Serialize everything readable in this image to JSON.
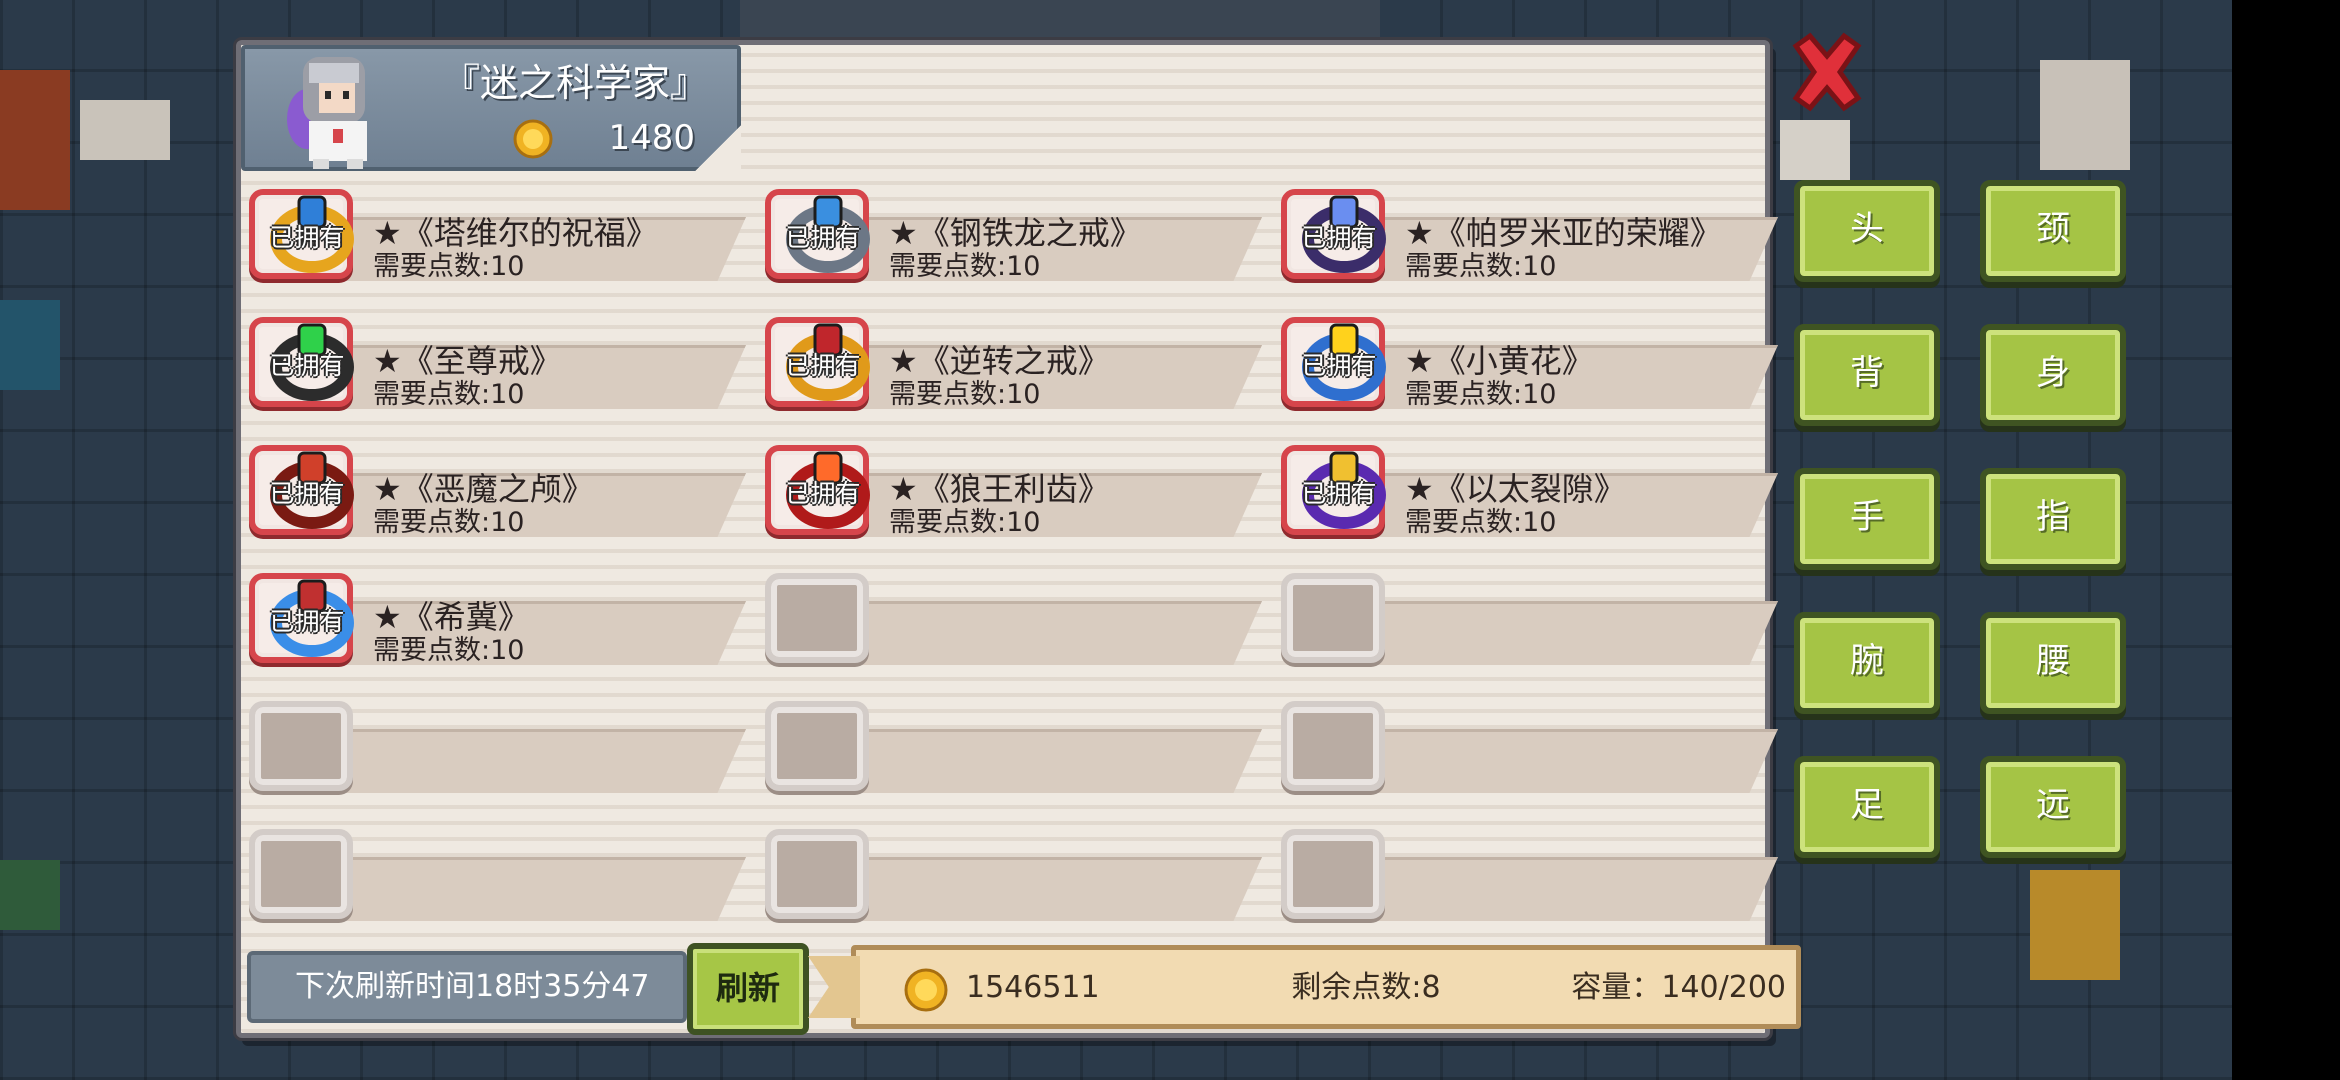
{
  "character": {
    "title": "『迷之科学家』",
    "coins": "1480"
  },
  "owned_label": "已拥有",
  "items": [
    {
      "name": "★《塔维尔的祝福》",
      "cost": "需要点数:10",
      "icon": "ring-gold-blue-gem-icon",
      "owned": true
    },
    {
      "name": "★《钢铁龙之戒》",
      "cost": "需要点数:10",
      "icon": "ring-steel-dragon-icon",
      "owned": true
    },
    {
      "name": "★《帕罗米亚的荣耀》",
      "cost": "需要点数:10",
      "icon": "ring-purple-crystal-icon",
      "owned": true
    },
    {
      "name": "★《至尊戒》",
      "cost": "需要点数:10",
      "icon": "ring-green-gem-icon",
      "owned": true
    },
    {
      "name": "★《逆转之戒》",
      "cost": "需要点数:10",
      "icon": "ring-red-gold-icon",
      "owned": true
    },
    {
      "name": "★《小黄花》",
      "cost": "需要点数:10",
      "icon": "ring-yellow-flower-icon",
      "owned": true
    },
    {
      "name": "★《恶魔之颅》",
      "cost": "需要点数:10",
      "icon": "ring-demon-skull-icon",
      "owned": true
    },
    {
      "name": "★《狼王利齿》",
      "cost": "需要点数:10",
      "icon": "ring-wolf-fang-icon",
      "owned": true
    },
    {
      "name": "★《以太裂隙》",
      "cost": "需要点数:10",
      "icon": "ring-ether-rift-icon",
      "owned": true
    },
    {
      "name": "★《希冀》",
      "cost": "需要点数:10",
      "icon": "ring-blue-hope-icon",
      "owned": true
    },
    {
      "name": "",
      "cost": "",
      "icon": "",
      "owned": false
    },
    {
      "name": "",
      "cost": "",
      "icon": "",
      "owned": false
    },
    {
      "name": "",
      "cost": "",
      "icon": "",
      "owned": false
    },
    {
      "name": "",
      "cost": "",
      "icon": "",
      "owned": false
    },
    {
      "name": "",
      "cost": "",
      "icon": "",
      "owned": false
    },
    {
      "name": "",
      "cost": "",
      "icon": "",
      "owned": false
    },
    {
      "name": "",
      "cost": "",
      "icon": "",
      "owned": false
    },
    {
      "name": "",
      "cost": "",
      "icon": "",
      "owned": false
    }
  ],
  "footer": {
    "refresh_time": "下次刷新时间18时35分47",
    "refresh_button": "刷新",
    "gold": "1546511",
    "remaining_points": "剩余点数:8",
    "capacity": "容量：140/200"
  },
  "categories": [
    "头",
    "颈",
    "背",
    "身",
    "手",
    "指",
    "腕",
    "腰",
    "足",
    "远"
  ],
  "colors": {
    "accent_green": "#a5c445",
    "owned_red": "#d6454b",
    "close_red": "#e0303a",
    "panel": "#efe9e1"
  }
}
